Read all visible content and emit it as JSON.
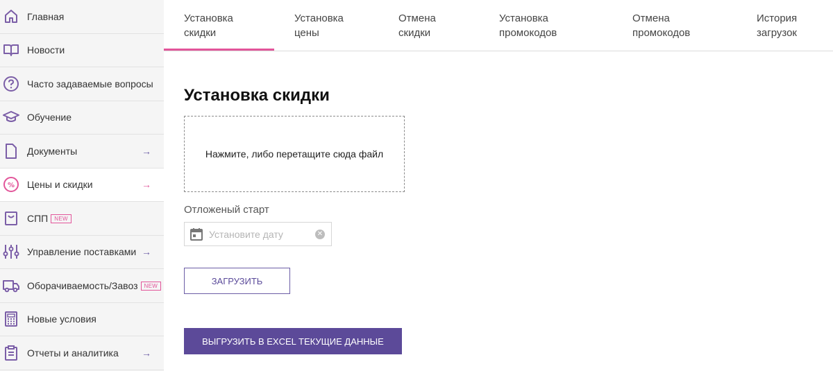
{
  "colors": {
    "accent_pink": "#e2559a",
    "accent_purple": "#5c4a99",
    "sidebar_bg": "#f5f5f5"
  },
  "sidebar": {
    "items": [
      {
        "label": "Главная",
        "icon": "home-icon",
        "arrow": "",
        "badge": ""
      },
      {
        "label": "Новости",
        "icon": "book-icon",
        "arrow": "",
        "badge": ""
      },
      {
        "label": "Часто задаваемые вопросы",
        "icon": "question-icon",
        "arrow": "",
        "badge": ""
      },
      {
        "label": "Обучение",
        "icon": "graduation-cap-icon",
        "arrow": "",
        "badge": ""
      },
      {
        "label": "Документы",
        "icon": "document-icon",
        "arrow": "→",
        "badge": ""
      },
      {
        "label": "Цены и скидки",
        "icon": "percent-icon",
        "arrow": "→",
        "badge": "",
        "active": true
      },
      {
        "label": "СПП",
        "icon": "bag-icon",
        "arrow": "",
        "badge": "NEW"
      },
      {
        "label": "Управление поставками",
        "icon": "sliders-icon",
        "arrow": "→",
        "badge": ""
      },
      {
        "label": "Оборачиваемость/Завоз",
        "icon": "truck-icon",
        "arrow": "",
        "badge": "NEW"
      },
      {
        "label": "Новые условия",
        "icon": "calculator-icon",
        "arrow": "",
        "badge": ""
      },
      {
        "label": "Отчеты и аналитика",
        "icon": "clipboard-icon",
        "arrow": "→",
        "badge": ""
      }
    ]
  },
  "tabs": [
    {
      "label": "Установка\nскидки",
      "active": true
    },
    {
      "label": "Установка\nцены"
    },
    {
      "label": "Отмена\nскидки"
    },
    {
      "label": "Установка\nпромокодов"
    },
    {
      "label": "Отмена\nпромокодов"
    },
    {
      "label": "История\nзагрузок"
    }
  ],
  "main": {
    "title": "Установка скидки",
    "dropzone_text": "Нажмите, либо перетащите сюда файл",
    "delayed_start_label": "Отложеный старт",
    "date_placeholder": "Установите дату",
    "upload_button": "ЗАГРУЗИТЬ",
    "export_button": "ВЫГРУЗИТЬ В EXCEL ТЕКУЩИЕ ДАННЫЕ"
  }
}
